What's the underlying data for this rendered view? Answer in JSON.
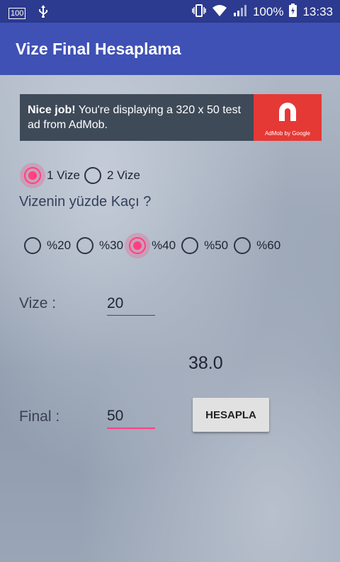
{
  "status_bar": {
    "left_icons": [
      "notification-100-icon",
      "usb-icon"
    ],
    "battery_percent": "100%",
    "time": "13:33"
  },
  "app_bar": {
    "title": "Vize Final Hesaplama"
  },
  "ad": {
    "headline": "Nice job!",
    "text": " You're displaying a 320 x 50 test ad from AdMob.",
    "logo_caption": "AdMob by Google",
    "logo_color": "#e53935"
  },
  "vize_count": {
    "options": [
      "1 Vize",
      "2 Vize"
    ],
    "selected": "1 Vize"
  },
  "question": "Vizenin yüzde Kaçı ?",
  "percent_options": {
    "options": [
      "%20",
      "%30",
      "%40",
      "%50",
      "%60"
    ],
    "selected": "%40"
  },
  "vize": {
    "label": "Vize :",
    "value": "20"
  },
  "result": "38.0",
  "final": {
    "label": "Final :",
    "value": "50"
  },
  "calculate_button": "HESAPLA",
  "colors": {
    "primary": "#3f51b5",
    "primary_dark": "#2c3a8f",
    "accent": "#ff4081"
  }
}
